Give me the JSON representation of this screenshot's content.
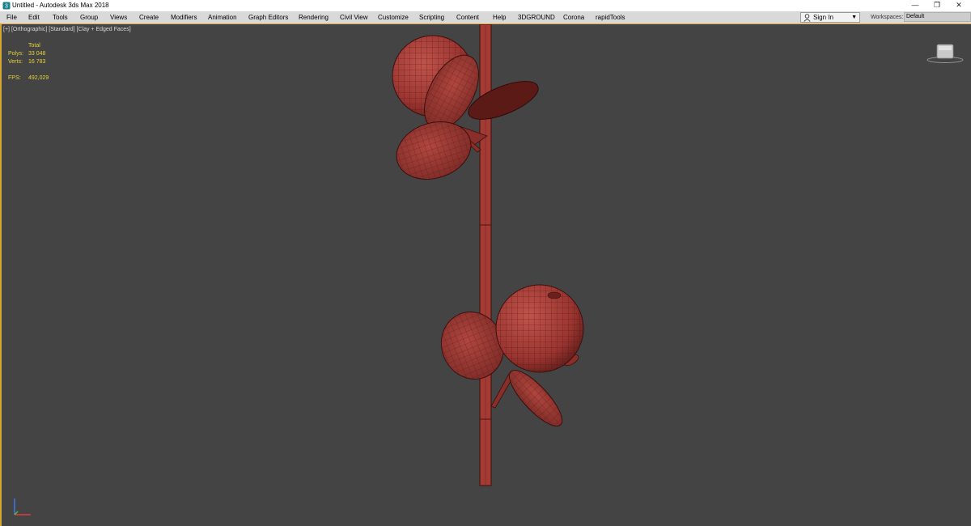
{
  "window": {
    "title": "Untitled - Autodesk 3ds Max 2018",
    "controls": [
      "—",
      "❐",
      "✕"
    ]
  },
  "menu": {
    "items": [
      "File",
      "Edit",
      "Tools",
      "Group",
      "Views",
      "Create",
      "Modifiers",
      "Animation",
      "Graph Editors",
      "Rendering",
      "Civil View",
      "Customize",
      "Scripting",
      "Content",
      "Help",
      "3DGROUND",
      "Corona",
      "rapidTools"
    ],
    "signin_label": "Sign In",
    "workspaces_label": "Workspaces:",
    "workspace_value": "Default"
  },
  "viewport": {
    "label_plus": "[+]",
    "label_view": "[Orthographic]",
    "label_shading": "[Standard]",
    "label_mode": "[Clay + Edged Faces]",
    "stats": {
      "total_label": "Total",
      "polys_label": "Polys:",
      "polys_value": "33 048",
      "verts_label": "Verts:",
      "verts_value": "16 783",
      "fps_label": "FPS:",
      "fps_value": "492,029"
    }
  },
  "colors": {
    "viewport_bg": "#444444",
    "clay": "#a33a34",
    "stats_text": "#e6d23a",
    "active_border": "#d4a632"
  },
  "icons": [
    "3dsmax-app-icon",
    "user-icon",
    "dropdown-caret-icon",
    "viewcube-icon",
    "axis-tripod-icon"
  ]
}
